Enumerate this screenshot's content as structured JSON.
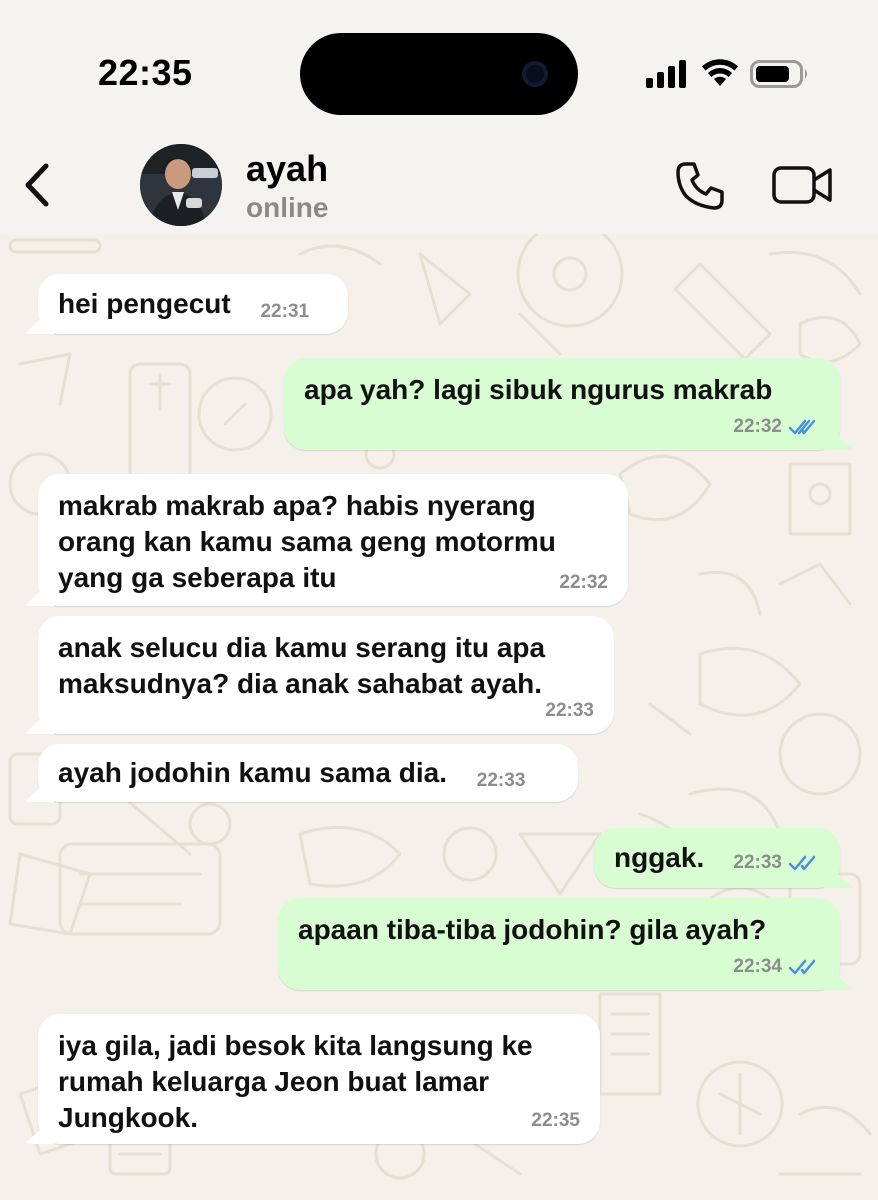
{
  "status_bar": {
    "time": "22:35"
  },
  "header": {
    "back_icon": "chevron-left-icon",
    "contact_name": "ayah",
    "contact_status": "online",
    "call_icon": "phone-icon",
    "video_icon": "video-camera-icon"
  },
  "colors": {
    "incoming_bubble": "#ffffff",
    "outgoing_bubble": "#d9fdd3",
    "read_ticks": "#4a90e2",
    "wallpaper": "#f5f1ea"
  },
  "messages": [
    {
      "direction": "in",
      "text": "hei pengecut",
      "time": "22:31"
    },
    {
      "direction": "out",
      "text": "apa yah? lagi sibuk ngurus makrab",
      "time": "22:32",
      "status": "read"
    },
    {
      "direction": "in",
      "text": "makrab makrab apa? habis nyerang\norang kan kamu sama geng motormu\nyang ga seberapa itu",
      "time": "22:32"
    },
    {
      "direction": "in",
      "text": "anak selucu dia kamu serang itu apa\nmaksudnya? dia anak sahabat ayah.",
      "time": "22:33"
    },
    {
      "direction": "in",
      "text": "ayah jodohin kamu sama dia.",
      "time": "22:33"
    },
    {
      "direction": "out",
      "text": "nggak.",
      "time": "22:33",
      "status": "read"
    },
    {
      "direction": "out",
      "text": "apaan tiba-tiba jodohin? gila ayah?",
      "time": "22:34",
      "status": "read"
    },
    {
      "direction": "in",
      "text": "iya gila, jadi besok kita langsung ke\nrumah keluarga Jeon buat lamar\nJungkook.",
      "time": "22:35"
    }
  ]
}
